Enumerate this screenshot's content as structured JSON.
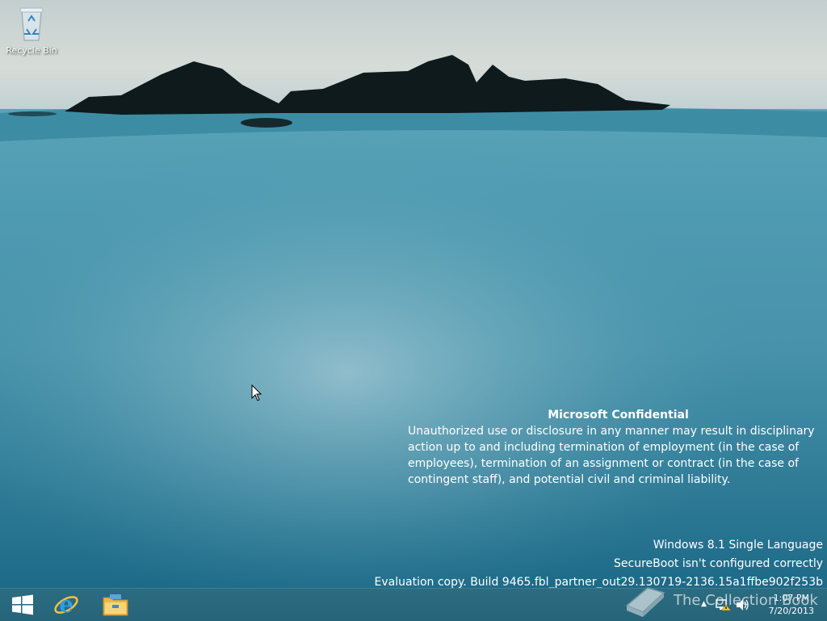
{
  "desktop": {
    "icons": [
      {
        "label": "Recycle Bin",
        "icon": "recycle-bin-icon"
      }
    ]
  },
  "notice": {
    "title": "Microsoft Confidential",
    "body": "Unauthorized use or disclosure in any manner may result in disciplinary action up to and including termination of employment (in the case of employees), termination of an assignment or contract (in the case of contingent staff), and potential civil and criminal liability."
  },
  "watermark": {
    "edition": "Windows 8.1 Single Language",
    "secureboot": "SecureBoot isn't configured correctly",
    "build": "Evaluation copy. Build 9465.fbl_partner_out29.130719-2136.15a1ffbe902f253b"
  },
  "taskbar": {
    "pinned": [
      {
        "name": "Start",
        "icon": "windows-logo-icon"
      },
      {
        "name": "Internet Explorer",
        "icon": "internet-explorer-icon"
      },
      {
        "name": "File Explorer",
        "icon": "file-explorer-icon"
      }
    ],
    "tray": {
      "time": "1:07 PM",
      "date": "7/20/2013",
      "icons": [
        "show-hidden-icons-arrow",
        "network-icon",
        "volume-icon"
      ]
    }
  },
  "overlay_logo": {
    "text": "The Collection Book",
    "icon": "book-icon"
  },
  "colors": {
    "taskbar": "#26647a",
    "text": "#ffffff"
  }
}
